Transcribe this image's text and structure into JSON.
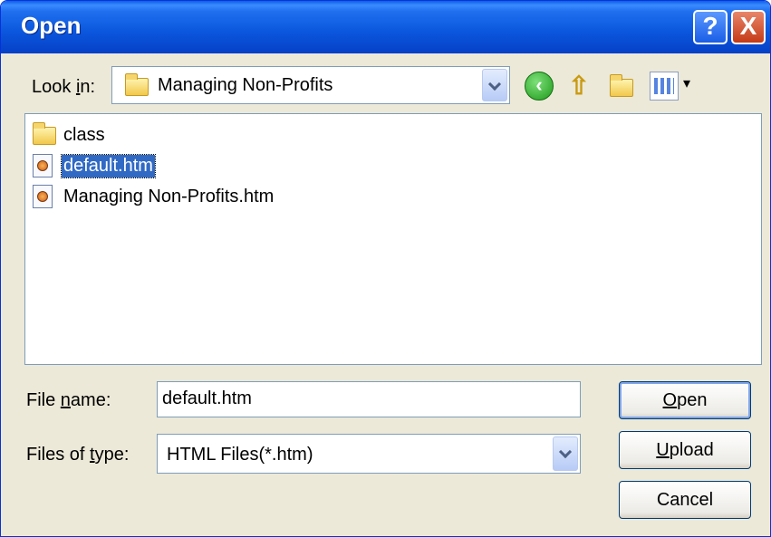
{
  "window": {
    "title": "Open"
  },
  "titlebar_buttons": {
    "help": "?",
    "close": "X"
  },
  "lookin": {
    "label_pre": "Look ",
    "label_key": "i",
    "label_post": "n:",
    "value": "Managing Non-Profits"
  },
  "toolbar": {
    "back": "back-icon",
    "up": "up-folder-icon",
    "new_folder": "new-folder-icon",
    "views": "views-menu-icon"
  },
  "files": [
    {
      "name": "class",
      "type": "folder"
    },
    {
      "name": "default.htm",
      "type": "file",
      "selected": true
    },
    {
      "name": "Managing Non-Profits.htm",
      "type": "file"
    }
  ],
  "filename": {
    "label_pre": "File ",
    "label_key": "n",
    "label_post": "ame:",
    "value": "default.htm"
  },
  "filetype": {
    "label_pre": "Files of ",
    "label_key": "t",
    "label_post": "ype:",
    "value": "HTML Files(*.htm)"
  },
  "buttons": {
    "open_key": "O",
    "open_rest": "pen",
    "upload_key": "U",
    "upload_rest": "pload",
    "cancel": "Cancel"
  },
  "colors": {
    "title_bar": "#0a56dc",
    "selection": "#316ac5",
    "dialog_bg": "#ece9d8"
  }
}
